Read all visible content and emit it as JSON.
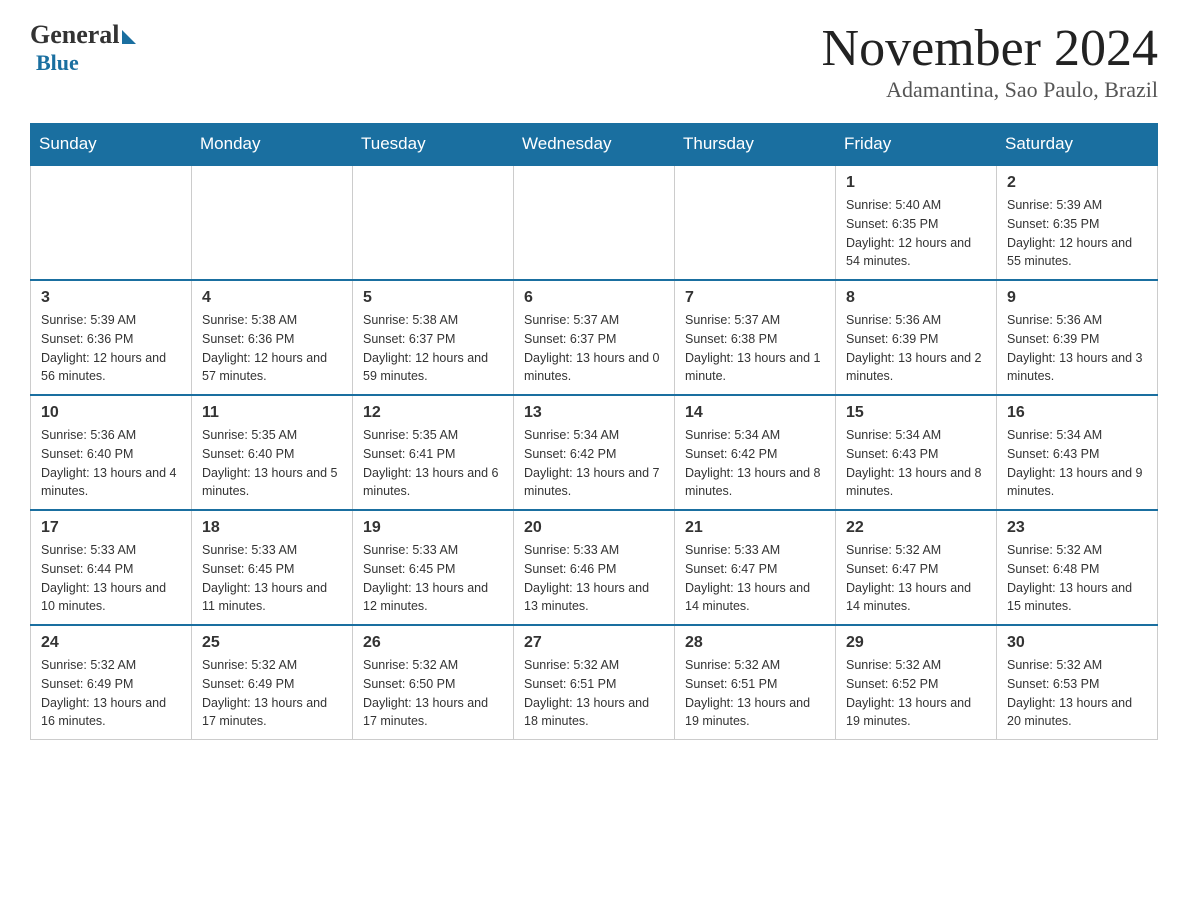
{
  "header": {
    "logo_general": "General",
    "logo_blue": "Blue",
    "month_title": "November 2024",
    "location": "Adamantina, Sao Paulo, Brazil"
  },
  "days_of_week": [
    "Sunday",
    "Monday",
    "Tuesday",
    "Wednesday",
    "Thursday",
    "Friday",
    "Saturday"
  ],
  "weeks": [
    [
      {
        "day": "",
        "info": ""
      },
      {
        "day": "",
        "info": ""
      },
      {
        "day": "",
        "info": ""
      },
      {
        "day": "",
        "info": ""
      },
      {
        "day": "",
        "info": ""
      },
      {
        "day": "1",
        "info": "Sunrise: 5:40 AM\nSunset: 6:35 PM\nDaylight: 12 hours and 54 minutes."
      },
      {
        "day": "2",
        "info": "Sunrise: 5:39 AM\nSunset: 6:35 PM\nDaylight: 12 hours and 55 minutes."
      }
    ],
    [
      {
        "day": "3",
        "info": "Sunrise: 5:39 AM\nSunset: 6:36 PM\nDaylight: 12 hours and 56 minutes."
      },
      {
        "day": "4",
        "info": "Sunrise: 5:38 AM\nSunset: 6:36 PM\nDaylight: 12 hours and 57 minutes."
      },
      {
        "day": "5",
        "info": "Sunrise: 5:38 AM\nSunset: 6:37 PM\nDaylight: 12 hours and 59 minutes."
      },
      {
        "day": "6",
        "info": "Sunrise: 5:37 AM\nSunset: 6:37 PM\nDaylight: 13 hours and 0 minutes."
      },
      {
        "day": "7",
        "info": "Sunrise: 5:37 AM\nSunset: 6:38 PM\nDaylight: 13 hours and 1 minute."
      },
      {
        "day": "8",
        "info": "Sunrise: 5:36 AM\nSunset: 6:39 PM\nDaylight: 13 hours and 2 minutes."
      },
      {
        "day": "9",
        "info": "Sunrise: 5:36 AM\nSunset: 6:39 PM\nDaylight: 13 hours and 3 minutes."
      }
    ],
    [
      {
        "day": "10",
        "info": "Sunrise: 5:36 AM\nSunset: 6:40 PM\nDaylight: 13 hours and 4 minutes."
      },
      {
        "day": "11",
        "info": "Sunrise: 5:35 AM\nSunset: 6:40 PM\nDaylight: 13 hours and 5 minutes."
      },
      {
        "day": "12",
        "info": "Sunrise: 5:35 AM\nSunset: 6:41 PM\nDaylight: 13 hours and 6 minutes."
      },
      {
        "day": "13",
        "info": "Sunrise: 5:34 AM\nSunset: 6:42 PM\nDaylight: 13 hours and 7 minutes."
      },
      {
        "day": "14",
        "info": "Sunrise: 5:34 AM\nSunset: 6:42 PM\nDaylight: 13 hours and 8 minutes."
      },
      {
        "day": "15",
        "info": "Sunrise: 5:34 AM\nSunset: 6:43 PM\nDaylight: 13 hours and 8 minutes."
      },
      {
        "day": "16",
        "info": "Sunrise: 5:34 AM\nSunset: 6:43 PM\nDaylight: 13 hours and 9 minutes."
      }
    ],
    [
      {
        "day": "17",
        "info": "Sunrise: 5:33 AM\nSunset: 6:44 PM\nDaylight: 13 hours and 10 minutes."
      },
      {
        "day": "18",
        "info": "Sunrise: 5:33 AM\nSunset: 6:45 PM\nDaylight: 13 hours and 11 minutes."
      },
      {
        "day": "19",
        "info": "Sunrise: 5:33 AM\nSunset: 6:45 PM\nDaylight: 13 hours and 12 minutes."
      },
      {
        "day": "20",
        "info": "Sunrise: 5:33 AM\nSunset: 6:46 PM\nDaylight: 13 hours and 13 minutes."
      },
      {
        "day": "21",
        "info": "Sunrise: 5:33 AM\nSunset: 6:47 PM\nDaylight: 13 hours and 14 minutes."
      },
      {
        "day": "22",
        "info": "Sunrise: 5:32 AM\nSunset: 6:47 PM\nDaylight: 13 hours and 14 minutes."
      },
      {
        "day": "23",
        "info": "Sunrise: 5:32 AM\nSunset: 6:48 PM\nDaylight: 13 hours and 15 minutes."
      }
    ],
    [
      {
        "day": "24",
        "info": "Sunrise: 5:32 AM\nSunset: 6:49 PM\nDaylight: 13 hours and 16 minutes."
      },
      {
        "day": "25",
        "info": "Sunrise: 5:32 AM\nSunset: 6:49 PM\nDaylight: 13 hours and 17 minutes."
      },
      {
        "day": "26",
        "info": "Sunrise: 5:32 AM\nSunset: 6:50 PM\nDaylight: 13 hours and 17 minutes."
      },
      {
        "day": "27",
        "info": "Sunrise: 5:32 AM\nSunset: 6:51 PM\nDaylight: 13 hours and 18 minutes."
      },
      {
        "day": "28",
        "info": "Sunrise: 5:32 AM\nSunset: 6:51 PM\nDaylight: 13 hours and 19 minutes."
      },
      {
        "day": "29",
        "info": "Sunrise: 5:32 AM\nSunset: 6:52 PM\nDaylight: 13 hours and 19 minutes."
      },
      {
        "day": "30",
        "info": "Sunrise: 5:32 AM\nSunset: 6:53 PM\nDaylight: 13 hours and 20 minutes."
      }
    ]
  ]
}
